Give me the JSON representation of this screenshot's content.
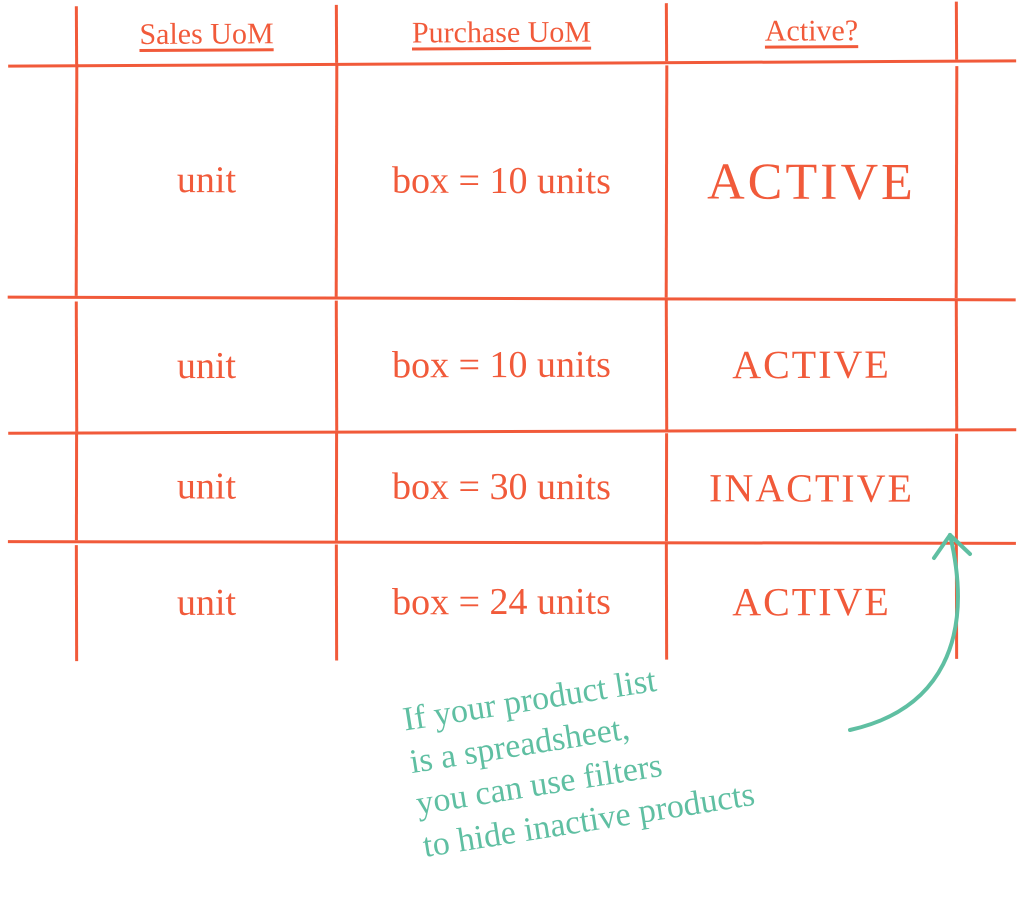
{
  "table": {
    "headers": {
      "sales": "Sales UoM",
      "purchase": "Purchase UoM",
      "active": "Active?"
    },
    "rows": [
      {
        "sales": "unit",
        "purchase": "box = 10 units",
        "status": "ACTIVE"
      },
      {
        "sales": "unit",
        "purchase": "box = 10 units",
        "status": "ACTIVE"
      },
      {
        "sales": "unit",
        "purchase": "box = 30 units",
        "status": "INACTIVE"
      },
      {
        "sales": "unit",
        "purchase": "box = 24 units",
        "status": "ACTIVE"
      }
    ]
  },
  "annotation": {
    "line1": "If your product list",
    "line2": "is a spreadsheet,",
    "line3": "you can use filters",
    "line4": "to hide inactive products"
  }
}
